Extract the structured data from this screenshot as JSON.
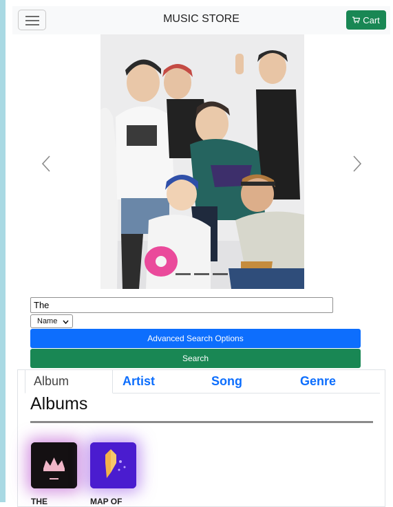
{
  "navbar": {
    "brand": "MUSIC STORE",
    "cart_label": "Cart",
    "cart_color": "#198754"
  },
  "carousel": {
    "prev_icon": "chevron-left-icon",
    "next_icon": "chevron-right-icon",
    "indicator_count": 3
  },
  "search": {
    "value": "The",
    "filter_selected": "Name",
    "advanced_label": "Advanced Search Options",
    "search_label": "Search"
  },
  "tabs": [
    {
      "label": "Album",
      "active": true
    },
    {
      "label": "Artist",
      "active": false
    },
    {
      "label": "Song",
      "active": false
    },
    {
      "label": "Genre",
      "active": false
    }
  ],
  "section": {
    "heading": "Albums"
  },
  "albums": [
    {
      "label": "THE"
    },
    {
      "label": "MAP OF"
    }
  ],
  "colors": {
    "primary": "#0d6efd",
    "success": "#198754",
    "rail": "#a9d9e3"
  }
}
